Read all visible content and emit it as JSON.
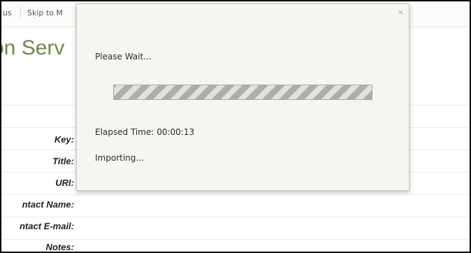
{
  "page": {
    "nav": {
      "item_1": "us",
      "item_2": "Skip to M"
    },
    "title": "on Serv",
    "form_labels": [
      "Key:",
      "Title:",
      "URI:",
      "ntact Name:",
      "ntact E-mail:",
      "Notes:"
    ]
  },
  "modal": {
    "close_symbol": "×",
    "message": "Please Wait...",
    "progress": {
      "percent": 100,
      "animated_stripes": true
    },
    "elapsed_label": "Elapsed Time:",
    "elapsed_value": "00:00:13",
    "status": "Importing..."
  },
  "colors": {
    "title_green": "#6e8b45",
    "modal_background": "#f6f5f2",
    "progress_stripe_dark": "#aeaea8",
    "progress_stripe_light": "#e2e2dd"
  }
}
